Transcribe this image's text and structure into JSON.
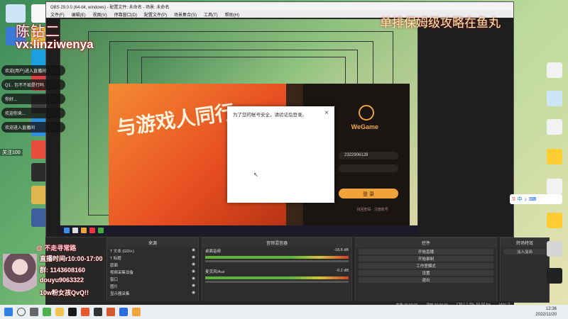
{
  "streamer": {
    "name": "陈钻二",
    "vx": "vx:linziwenya"
  },
  "top_marquee": "单排保姆级攻略在鱼丸",
  "chat": [
    "欢迎{用户}进入直播间",
    "Q1.. 包不不如是行吗",
    "你好...",
    "欢迎你来...",
    "欢迎进入直播间"
  ],
  "follower_tip": "关注100",
  "obs": {
    "title": "OBS 29.0.0 (64-bit, windows) - 配置文件: 未命名 - 场景: 未命名",
    "menu": [
      "文件(F)",
      "编辑(E)",
      "视图(V)",
      "停靠窗口(D)",
      "配置文件(P)",
      "场景集合(S)",
      "工具(T)",
      "帮助(H)"
    ],
    "docks": {
      "sources_header": "来源",
      "mixer_header": "音频混音器",
      "controls_header": "控件",
      "transitions_header": "转场特效",
      "sources": [
        "T 文本 (GDI+)",
        "T 标题",
        "层面",
        "视频采集设备",
        "窗口",
        "图片",
        "显示器采集"
      ],
      "mixer_tracks": [
        "桌面音频",
        "麦克风/Aux"
      ],
      "mixer_levels": [
        "-18.8 dB",
        "-0.2 dB"
      ],
      "controls": [
        "开始直播",
        "开始录制",
        "工作室模式",
        "设置",
        "退出"
      ],
      "transition_value": "淡入淡出"
    },
    "status": [
      "直播 00:00:00",
      "录制 00:00:00",
      "CPU: 1.3%, 60.00 fps",
      "kb/s: 0"
    ]
  },
  "launcher": {
    "slogan": "与游戏人同行",
    "brand": "WeGame",
    "account": "2322906128",
    "password_placeholder": "",
    "login_button": "登 录",
    "sub_links": "找回密码 · 注册账号"
  },
  "verify_dialog": {
    "title": "为了您的帐号安全，请验证后登录。",
    "close": "×"
  },
  "overlay": {
    "title": "@ 不走寻常路",
    "lines": [
      "直播时间r10:00-17:00",
      "群: 1143608160",
      "douyu9063322",
      "10w粉女孩QvQ!!"
    ]
  },
  "ime": {
    "label": "中"
  },
  "clock": {
    "time": "12:36",
    "date": "2022/11/20"
  },
  "colors": {
    "obs_bg": "#1e1e1e",
    "launcher_orange": "#f28a3a",
    "wegame_gold": "#f0a33a",
    "taskbar": "#e9eef3"
  }
}
